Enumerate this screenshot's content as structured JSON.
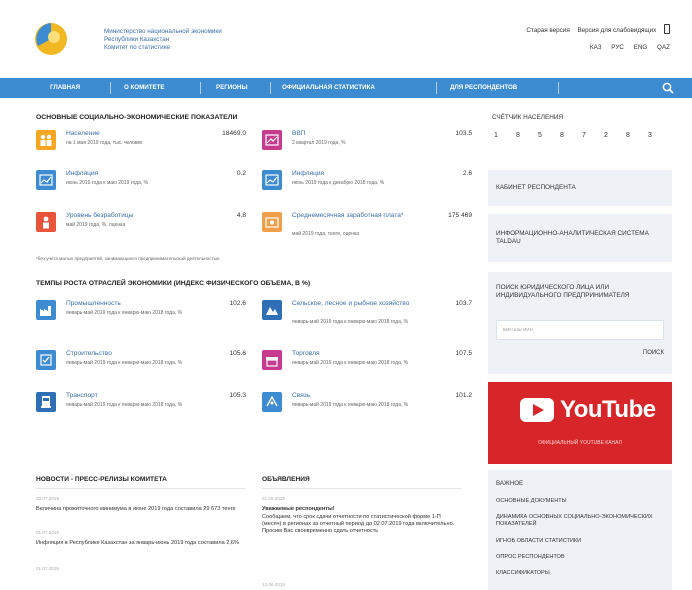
{
  "header": {
    "org_lines": [
      "Министерство национальной экономики",
      "Республики Казахстан",
      "Комитет по статистике"
    ],
    "top_links": [
      "Старая версия",
      "Версия для слабовидящих"
    ],
    "languages": [
      "КАЗ",
      "РУС",
      "ENG",
      "QAZ"
    ]
  },
  "nav": {
    "items": [
      "ГЛАВНАЯ",
      "О КОМИТЕТЕ",
      "РЕГИОНЫ",
      "ОФИЦИАЛЬНАЯ СТАТИСТИКА",
      "ДЛЯ РЕСПОНДЕНТОВ"
    ]
  },
  "indicators": {
    "title": "ОСНОВНЫЕ СОЦИАЛЬНО-ЭКОНОМИЧЕСКИЕ ПОКАЗАТЕЛИ",
    "items": [
      {
        "name": "Население",
        "sub": "на 1 мая 2019 года, тыс. человек",
        "value": "18469.0",
        "color": "#f5a623"
      },
      {
        "name": "ВВП",
        "sub": "2 квартал 2019 года, %",
        "value": "103.5",
        "color": "#c73b8f"
      },
      {
        "name": "Инфляция",
        "sub": "июнь 2019 года к маю 2019 года, %",
        "value": "0.2",
        "color": "#3d8bd1"
      },
      {
        "name": "Инфляция",
        "sub": "июнь 2019 года к декабрю 2018 года, %",
        "value": "2.6",
        "color": "#3d8bd1"
      },
      {
        "name": "Уровень безработицы",
        "sub": "май 2019 года, %, оценка",
        "value": "4.8",
        "color": "#e8553b"
      },
      {
        "name": "Среднемесячная заработная плата*",
        "sub": "май 2019 года, тенге, оценка",
        "value": "175 469",
        "color": "#f0a04b"
      }
    ],
    "footnote": "*без учета малых предприятий, занимающихся предпринимательской деятельностью"
  },
  "growth": {
    "title": "ТЕМПЫ РОСТА ОТРАСЛЕЙ ЭКОНОМИКИ (ИНДЕКС ФИЗИЧЕСКОГО ОБЪЕМА, В %)",
    "items": [
      {
        "name": "Промышленность",
        "sub": "январь-май 2019 года к январю-маю 2018 года, %",
        "value": "102.6",
        "color": "#3d8bd1"
      },
      {
        "name": "Сельское, лесное и рыбное хозяйство",
        "sub": "январь-май 2019 года к январю-маю 2018 года, %",
        "value": "103.7",
        "color": "#2f6fb5"
      },
      {
        "name": "Строительство",
        "sub": "январь-май 2019 года к январю-маю 2018 года, %",
        "value": "105.6",
        "color": "#3d8bd1"
      },
      {
        "name": "Торговля",
        "sub": "январь-май 2019 года к январю-маю 2018 года, %",
        "value": "107.5",
        "color": "#c73b8f"
      },
      {
        "name": "Транспорт",
        "sub": "январь-май 2019 года к январю-маю 2018 года, %",
        "value": "105.3",
        "color": "#2f6fb5"
      },
      {
        "name": "Связь",
        "sub": "январь-май 2019 года к январю-маю 2018 года, %",
        "value": "101.2",
        "color": "#3d8bd1"
      }
    ]
  },
  "sidebar": {
    "counter_title": "СЧЁТЧИК НАСЕЛЕНИЯ",
    "counter_digits": [
      "1",
      "8",
      "5",
      "8",
      "7",
      "2",
      "8",
      "3"
    ],
    "cabinet": "КАБИНЕТ РЕСПОНДЕНТА",
    "taldau": "ИНФОРМАЦИОННО-АНАЛИТИЧЕСКАЯ СИСТЕМА TALDAU",
    "search_title": "ПОИСК ЮРИДИЧЕСКОГО ЛИЦА ИЛИ ИНДИВИДУАЛЬНОГО ПРЕДПРИНИМАТЕЛЯ",
    "search_placeholder": "БИН или ИИН",
    "search_button": "ПОИСК",
    "youtube_word": "YouTube",
    "youtube_caption": "ОФИЦИАЛЬНЫЙ YOUTUBE КАНАЛ",
    "links_title": "ВАЖНОЕ",
    "links": [
      "ОСНОВНЫЕ ДОКУМЕНТЫ",
      "ДИНАМИКА ОСНОВНЫХ СОЦИАЛЬНО-ЭКОНОМИЧЕСКИХ ПОКАЗАТЕЛЕЙ",
      "ИГНОБ ОБЛАСТИ СТАТИСТИКИ",
      "ОПРОС РЕСПОНДЕНТОВ",
      "КЛАССИФИКАТОРЫ"
    ]
  },
  "news": {
    "title": "НОВОСТИ - ПРЕСС-РЕЛИЗЫ КОМИТЕТА",
    "items": [
      {
        "date": "03.07.2019",
        "text": "Величина прожиточного минимума в июне 2019 года составила 29 673 тенге"
      },
      {
        "date": "01.07.2019",
        "text": "Инфляция в Республике Казахстан за январь-июнь 2019 года составила 2,6%"
      },
      {
        "date": "01.07.2019",
        "text": ""
      }
    ]
  },
  "ads": {
    "title": "ОБЪЯВЛЕНИЯ",
    "items": [
      {
        "date": "21.06.2019",
        "head": "Уважаемые респонденты!",
        "text": "Сообщаем, что срок сдачи отчетности по статистической форме 1-П (месяч) в регионах за отчетный период до 02.07.2019 года включительно. Просим Вас своевременно сдать отчетность"
      },
      {
        "date": "12.06.2019",
        "head": "",
        "text": ""
      }
    ]
  }
}
